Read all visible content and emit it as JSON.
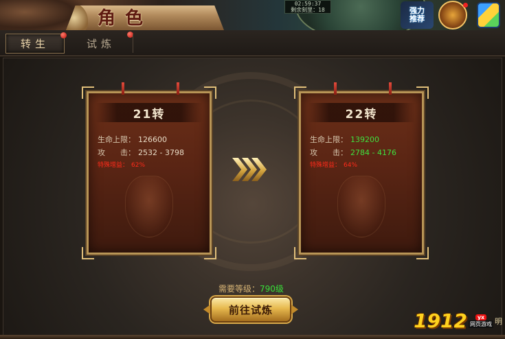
{
  "header": {
    "title": "角色",
    "timer": "02:59:37",
    "remaining_label": "剩余刻里：18",
    "promo_icon_label_line1": "强力",
    "promo_icon_label_line2": "推荐"
  },
  "tabs": [
    {
      "label": "转生",
      "active": true,
      "has_alert": true
    },
    {
      "label": "试炼",
      "active": false,
      "has_alert": true
    }
  ],
  "cards": {
    "current": {
      "title": "21转",
      "stats": {
        "hp_label": "生命上限：",
        "hp_value": "126600",
        "atk_label": "攻　　击：",
        "atk_value": "2532 - 3798",
        "bonus_label": "特殊增益：",
        "bonus_value": "62%"
      }
    },
    "next": {
      "title": "22转",
      "stats": {
        "hp_label": "生命上限：",
        "hp_value": "139200",
        "atk_label": "攻　　击：",
        "atk_value": "2784 - 4176",
        "bonus_label": "特殊增益：",
        "bonus_value": "64%"
      }
    }
  },
  "requirement": {
    "label": "需要等级：",
    "level": "790级"
  },
  "go_button_label": "前往试炼",
  "watermark": {
    "number": "1912",
    "badge": "yx",
    "sub": "网页游戏",
    "trailing": "明"
  },
  "colors": {
    "gold": "#d6b374",
    "green_value": "#3fe23f",
    "red_value": "#ff2a1a",
    "card_border": "#b89556"
  }
}
